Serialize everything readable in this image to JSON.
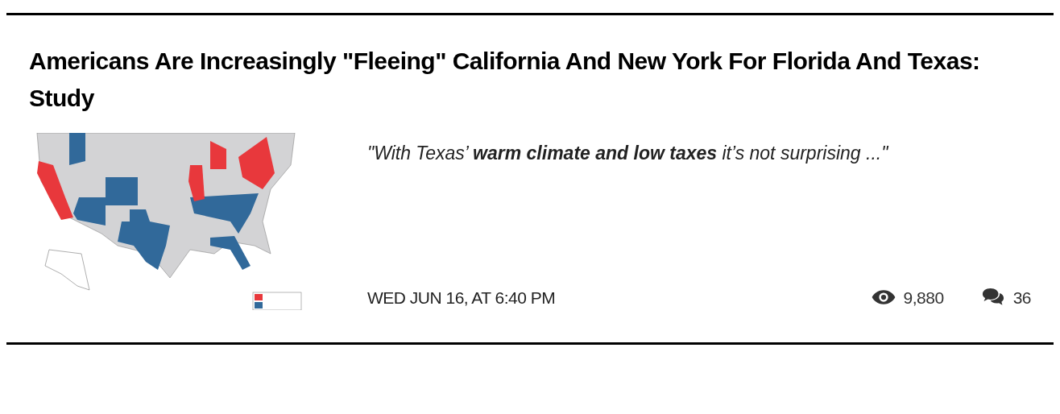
{
  "article": {
    "headline": "Americans Are Increasingly \"Fleeing\" California And New York For Florida And Texas: Study",
    "excerpt": "\"With Texas’ **warm climate and low taxes** it’s not surprising ...\"",
    "timestamp": "WED JUN 16, AT 6:40 PM",
    "views": "9,880",
    "comments": "36"
  }
}
